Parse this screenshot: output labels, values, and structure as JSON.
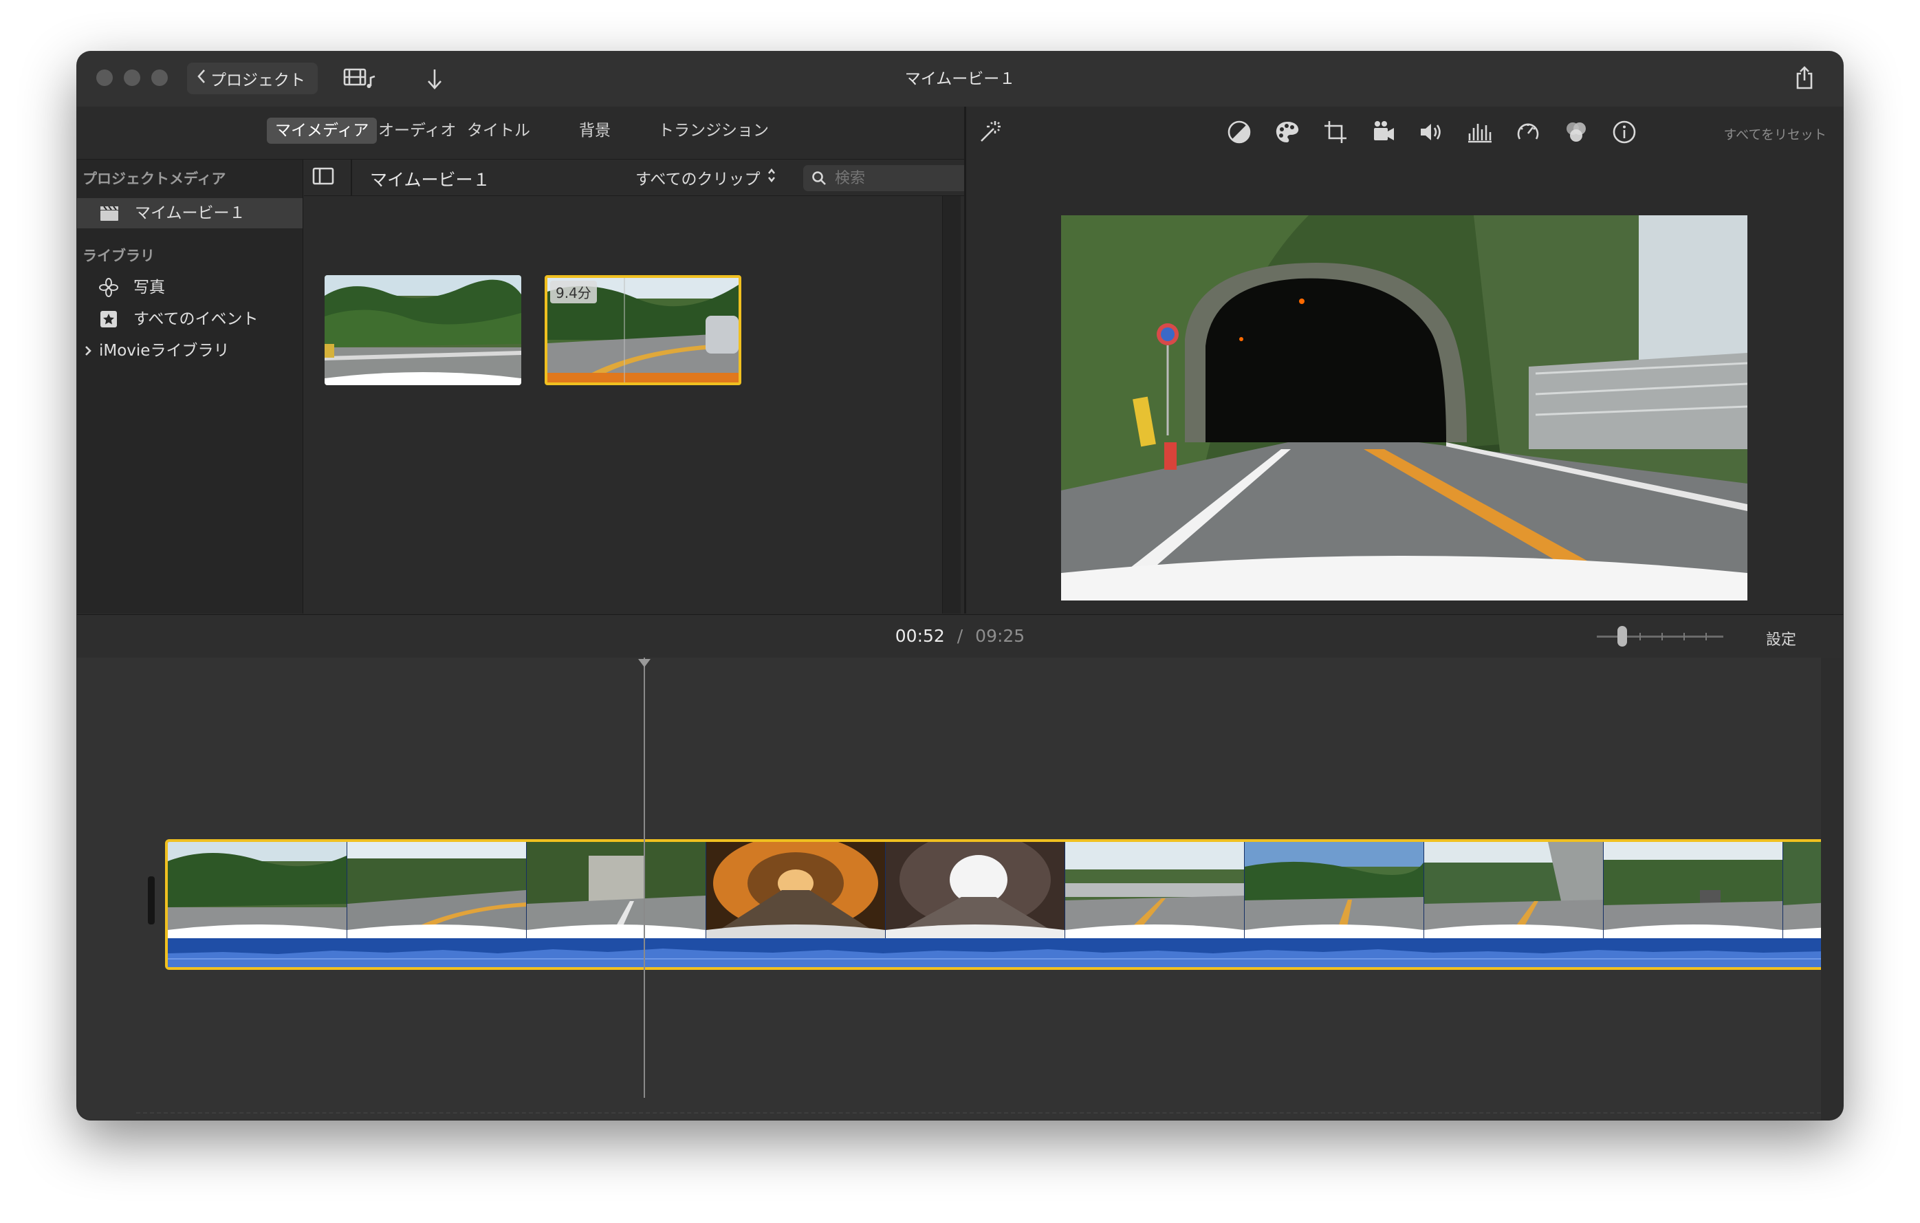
{
  "window": {
    "title": "マイムービー１",
    "back_label": "プロジェクト"
  },
  "browser": {
    "tabs": [
      {
        "label": "マイメディア",
        "active": true
      },
      {
        "label": "オーディオ",
        "active": false
      },
      {
        "label": "タイトル",
        "active": false
      },
      {
        "label": "背景",
        "active": false
      },
      {
        "label": "トランジション",
        "active": false
      }
    ],
    "media_title": "マイムービー１",
    "filter_label": "すべてのクリップ",
    "search_placeholder": "検索",
    "clips": [
      {
        "badge": ""
      },
      {
        "badge": "9.4分"
      }
    ]
  },
  "sidebar": {
    "project_media_header": "プロジェクトメディア",
    "project_item": "マイムービー１",
    "library_header": "ライブラリ",
    "library_items": [
      "写真",
      "すべてのイベント"
    ],
    "imovie_library": "iMovieライブラリ"
  },
  "viewer": {
    "reset_label": "すべてをリセット"
  },
  "timeline": {
    "current_time": "00:52",
    "separator": "/",
    "total_time": "09:25",
    "settings_label": "設定",
    "zoom_level": 0.2
  },
  "colors": {
    "clip_border": "#f0c020",
    "audio_wave": "#1f4ea6",
    "window_bg": "#2b2b2b"
  }
}
